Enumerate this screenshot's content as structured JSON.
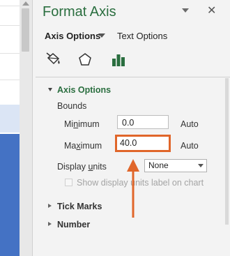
{
  "pane": {
    "title": "Format Axis",
    "close_glyph": "✕"
  },
  "tabs": {
    "axis_options": "Axis Options",
    "text_options": "Text Options"
  },
  "icons": [
    "fill-line-icon",
    "effects-icon",
    "axis-options-icon"
  ],
  "section": {
    "axis_options_title": "Axis Options",
    "bounds_label": "Bounds",
    "minimum_label_pre": "Mi",
    "minimum_label_u": "n",
    "minimum_label_post": "imum",
    "minimum_value": "0.0",
    "minimum_auto": "Auto",
    "maximum_label_pre": "Ma",
    "maximum_label_u": "x",
    "maximum_label_post": "imum",
    "maximum_value": "40.0",
    "maximum_auto": "Auto",
    "display_units_label_pre": "Display ",
    "display_units_label_u": "u",
    "display_units_label_post": "nits",
    "display_units_value": "None",
    "show_units_label": "Show display units label on chart"
  },
  "collapsed_sections": {
    "tick_marks": "Tick Marks",
    "number": "Number"
  },
  "colors": {
    "accent_green": "#2a6e3f",
    "highlight_orange": "#e0662a",
    "chart_blue": "#4472c4"
  }
}
